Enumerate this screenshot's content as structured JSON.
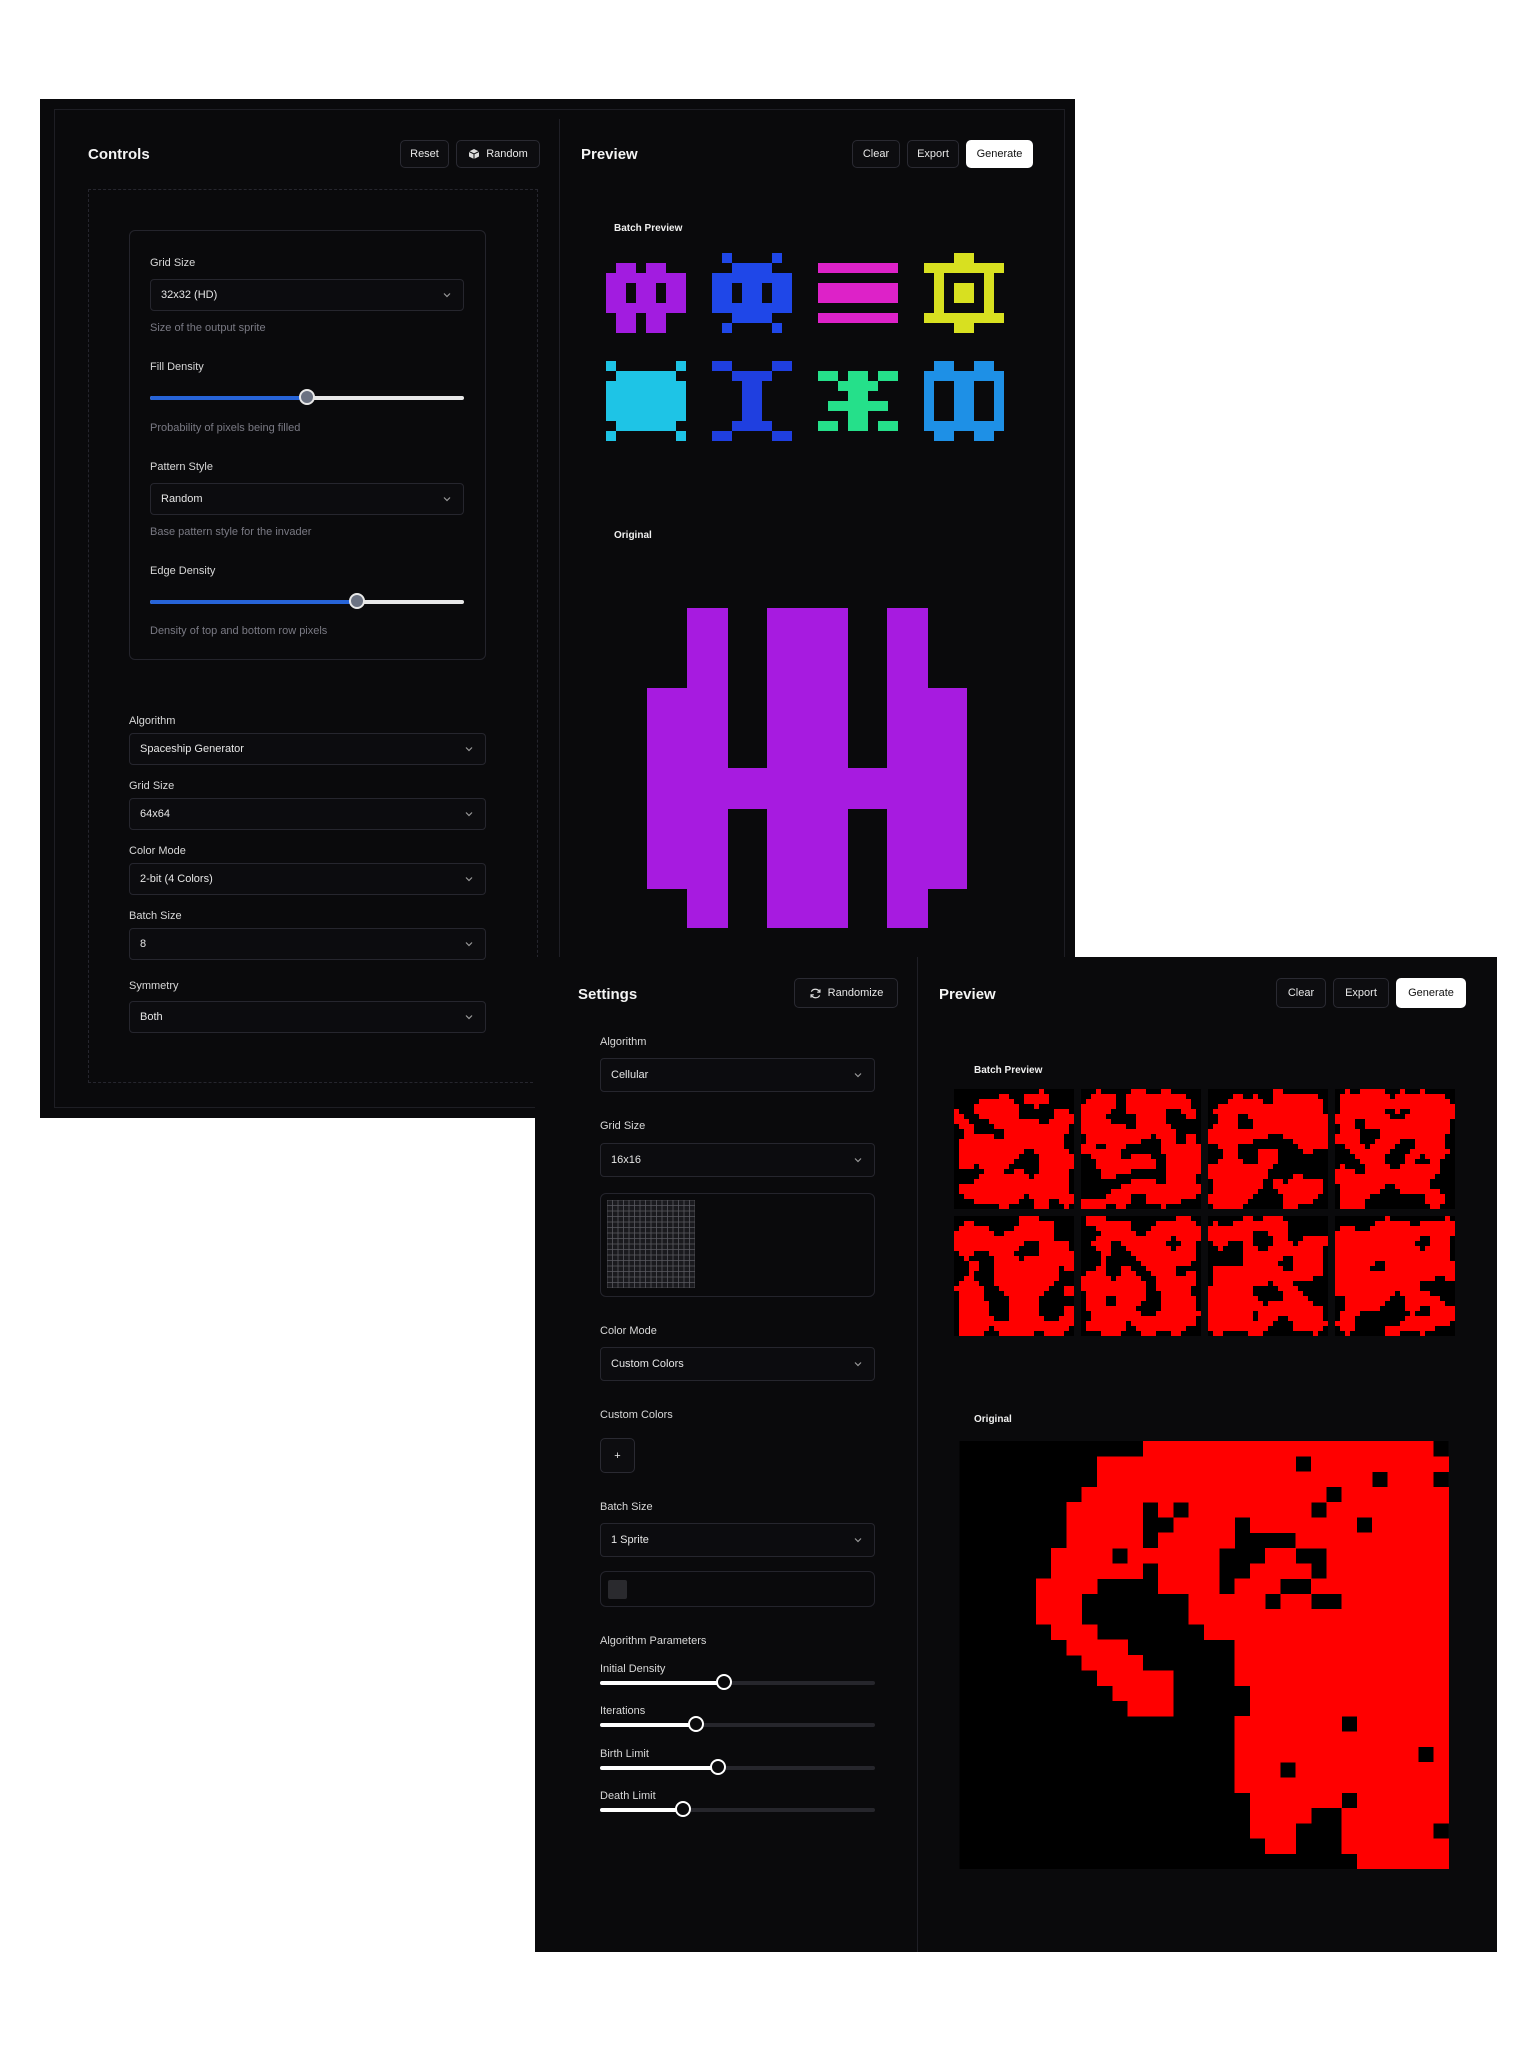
{
  "window1": {
    "controls_title": "Controls",
    "reset_label": "Reset",
    "random_label": "Random",
    "preview_title": "Preview",
    "clear_label": "Clear",
    "export_label": "Export",
    "generate_label": "Generate",
    "inner_panel": {
      "grid_size_label": "Grid Size",
      "grid_size_value": "32x32 (HD)",
      "grid_size_hint": "Size of the output sprite",
      "fill_density_label": "Fill Density",
      "fill_density_value": 0.5,
      "fill_density_hint": "Probability of pixels being filled",
      "pattern_style_label": "Pattern Style",
      "pattern_style_value": "Random",
      "pattern_style_hint": "Base pattern style for the invader",
      "edge_density_label": "Edge Density",
      "edge_density_value": 0.66,
      "edge_density_hint": "Density of top and bottom row pixels"
    },
    "algorithm_label": "Algorithm",
    "algorithm_value": "Spaceship Generator",
    "grid_size_label": "Grid Size",
    "grid_size_value": "64x64",
    "color_mode_label": "Color Mode",
    "color_mode_value": "2-bit (4 Colors)",
    "batch_size_label": "Batch Size",
    "batch_size_value": "8",
    "symmetry_label": "Symmetry",
    "symmetry_value": "Both",
    "batch_preview_label": "Batch Preview",
    "original_label": "Original",
    "batch_colors": [
      "#a21ce0",
      "#1f47e8",
      "#dd22c8",
      "#d8e020",
      "#1ec4e6",
      "#1f3fe0",
      "#25e08a",
      "#1e90e6"
    ],
    "original_color": "#a71be0"
  },
  "window2": {
    "settings_title": "Settings",
    "randomize_label": "Randomize",
    "preview_title": "Preview",
    "clear_label": "Clear",
    "export_label": "Export",
    "generate_label": "Generate",
    "algorithm_label": "Algorithm",
    "algorithm_value": "Cellular",
    "grid_size_label": "Grid Size",
    "grid_size_value": "16x16",
    "color_mode_label": "Color Mode",
    "color_mode_value": "Custom Colors",
    "custom_colors_label": "Custom Colors",
    "add_color_label": "+",
    "batch_size_label": "Batch Size",
    "batch_size_value": "1 Sprite",
    "algo_params_label": "Algorithm Parameters",
    "initial_density_label": "Initial Density",
    "initial_density_value": 0.45,
    "iterations_label": "Iterations",
    "iterations_value": 0.35,
    "birth_limit_label": "Birth Limit",
    "birth_limit_value": 0.43,
    "death_limit_label": "Death Limit",
    "death_limit_value": 0.3,
    "batch_preview_label": "Batch Preview",
    "original_label": "Original",
    "sprite_color": "#ff0000"
  }
}
